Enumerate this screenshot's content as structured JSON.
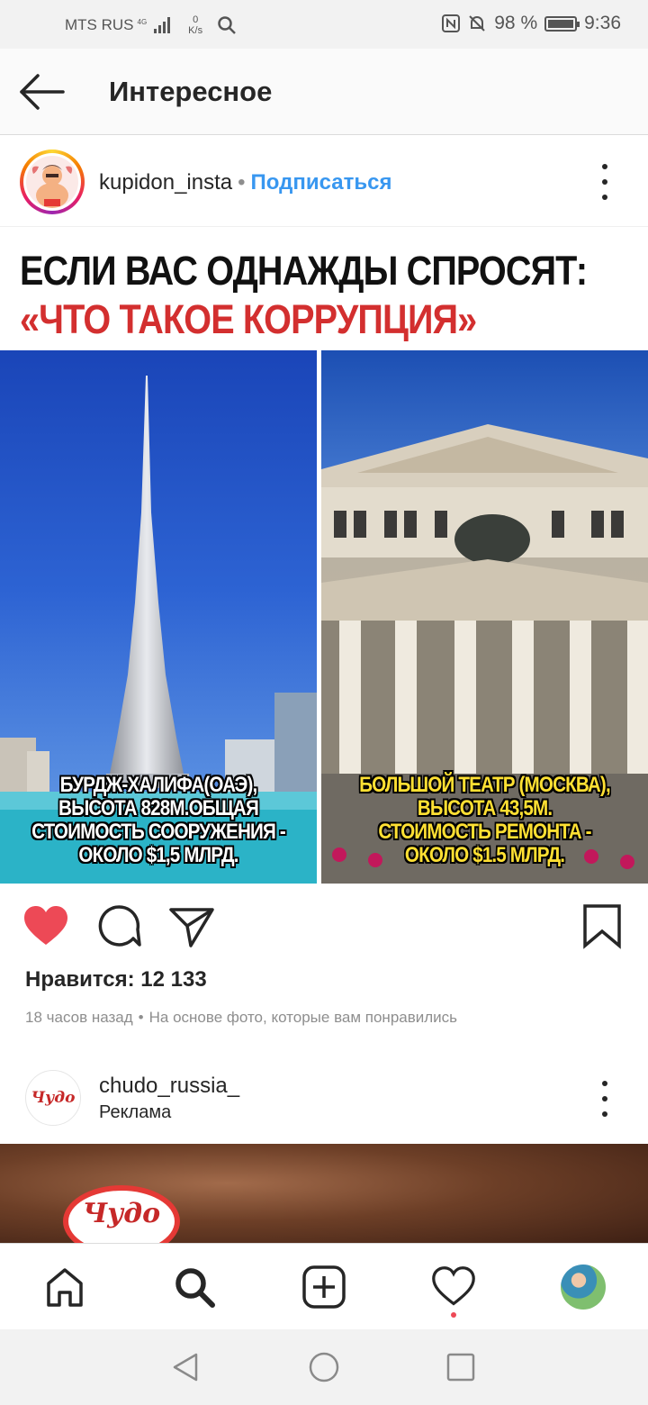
{
  "status_bar": {
    "carrier": "MTS RUS",
    "network": "4G",
    "speed_value": "0",
    "speed_unit": "K/s",
    "battery": "98 %",
    "battery_level": 0.98,
    "time": "9:36"
  },
  "header": {
    "title": "Интересное"
  },
  "post": {
    "username": "kupidon_insta",
    "separator": "•",
    "follow_label": "Подписаться",
    "image": {
      "headline_line1": "ЕСЛИ ВАС ОДНАЖДЫ СПРОСЯТ:",
      "headline_line2": "«ЧТО ТАКОЕ КОРРУПЦИЯ»",
      "left_caption": [
        "БУРДЖ-ХАЛИФА(ОАЭ),",
        "ВЫСОТА 828М.ОБЩАЯ",
        "СТОИМОСТЬ СООРУЖЕНИЯ -",
        "ОКОЛО $1,5 МЛРД."
      ],
      "right_caption": [
        "БОЛЬШОЙ ТЕАТР (МОСКВА),",
        "ВЫСОТА 43,5М.",
        "СТОИМОСТЬ РЕМОНТА -",
        "ОКОЛО $1.5 МЛРД."
      ]
    },
    "likes": "Нравится: 12 133",
    "time_ago": "18 часов назад",
    "meta_separator": "•",
    "reason": "На основе фото, которые вам понравились"
  },
  "ad": {
    "username": "chudo_russia_",
    "label": "Реклама",
    "logo_text": "Чудо"
  },
  "colors": {
    "link_blue": "#3897f0",
    "like_red": "#ed4956",
    "headline_red": "#d32f2f"
  },
  "icons": {
    "back": "arrow-left-icon",
    "like": "heart-filled-icon",
    "comment": "comment-icon",
    "share": "paper-plane-icon",
    "save": "bookmark-icon",
    "home": "home-icon",
    "search": "search-icon",
    "add": "add-post-icon",
    "activity": "heart-outline-icon"
  }
}
